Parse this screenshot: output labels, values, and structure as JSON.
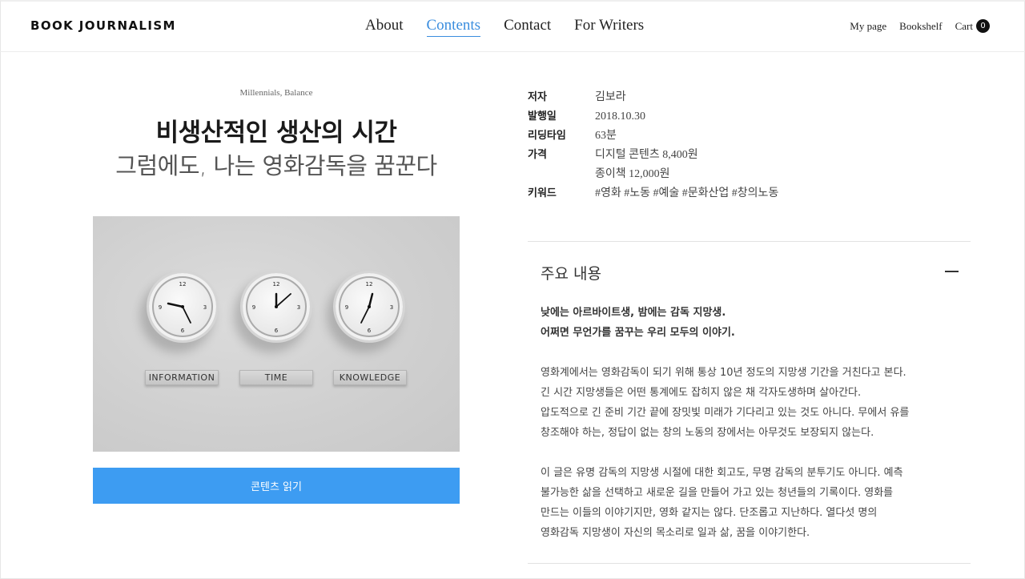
{
  "header": {
    "logo": "BOOK JOURNALISM",
    "nav": [
      "About",
      "Contents",
      "Contact",
      "For Writers"
    ],
    "util": {
      "mypage": "My page",
      "bookshelf": "Bookshelf",
      "cart": "Cart",
      "cart_count": "0"
    }
  },
  "book": {
    "category": "Millennials, Balance",
    "title": "비생산적인 생산의 시간",
    "subtitle": "그럼에도, 나는 영화감독을 꿈꾼다",
    "cover_plates": [
      "INFORMATION",
      "TIME",
      "KNOWLEDGE"
    ],
    "read_button": "콘텐츠 읽기"
  },
  "meta": {
    "author_label": "저자",
    "author": "김보라",
    "date_label": "발행일",
    "date": "2018.10.30",
    "reading_label": "리딩타임",
    "reading": "63분",
    "price_label": "가격",
    "price_digital": "디지털 콘텐츠 8,400원",
    "price_paper": "종이책 12,000원",
    "keyword_label": "키워드",
    "keywords": "#영화 #노동 #예술 #문화산업 #창의노동"
  },
  "summary": {
    "heading": "주요 내용",
    "lead1": "낮에는 아르바이트생, 밤에는 감독 지망생.",
    "lead2": "어쩌면 무언가를 꿈꾸는 우리 모두의 이야기.",
    "p1": [
      "영화계에서는 영화감독이 되기 위해 통상 10년 정도의 지망생 기간을 거친다고 본다.",
      "긴 시간 지망생들은 어떤 통계에도 잡히지 않은 채 각자도생하며 살아간다.",
      "압도적으로 긴 준비 기간 끝에 장밋빛 미래가 기다리고 있는 것도 아니다.  무에서 유를",
      "창조해야 하는, 정답이 없는 창의 노동의 장에서는 아무것도 보장되지 않는다."
    ],
    "p2": [
      "이 글은 유명 감독의 지망생 시절에 대한 회고도, 무명 감독의 분투기도 아니다. 예측",
      "불가능한 삶을 선택하고 새로운 길을 만들어 가고 있는 청년들의 기록이다. 영화를",
      "만드는 이들의 이야기지만, 영화 같지는 않다. 단조롭고 지난하다. 열다섯 명의",
      "영화감독 지망생이 자신의 목소리로 일과 삶, 꿈을 이야기한다."
    ]
  }
}
